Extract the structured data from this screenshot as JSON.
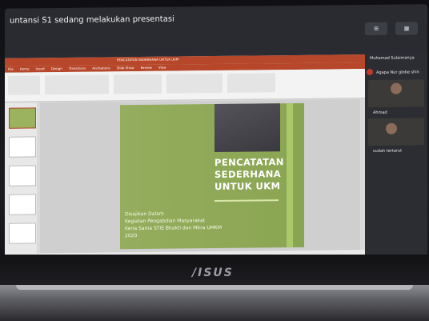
{
  "meet": {
    "title": "untansi S1 sedang melakukan presentasi",
    "buttons": [
      "",
      ""
    ]
  },
  "ppt": {
    "window_title": "PENCATATAN SEDERHANA UNTUK UKM",
    "tabs": [
      "File",
      "Home",
      "Insert",
      "Design",
      "Transitions",
      "Animations",
      "Slide Show",
      "Review",
      "View"
    ]
  },
  "slide": {
    "heading": [
      "PENCATATAN",
      "SEDERHANA",
      "UNTUK UKM"
    ],
    "subtitle": [
      "Disajikan Dalam",
      "Kegiatan Pengabdian Masyarakat",
      "Keria Sama STIE Bhakti dan Mitra UMKM",
      "2020"
    ]
  },
  "panel": {
    "names": [
      "Muhamad Sulaimanya",
      "Agapa Nur globe shin",
      "Ahmad",
      "sudah tertarut"
    ]
  },
  "device": {
    "brand": "/ISUS"
  }
}
